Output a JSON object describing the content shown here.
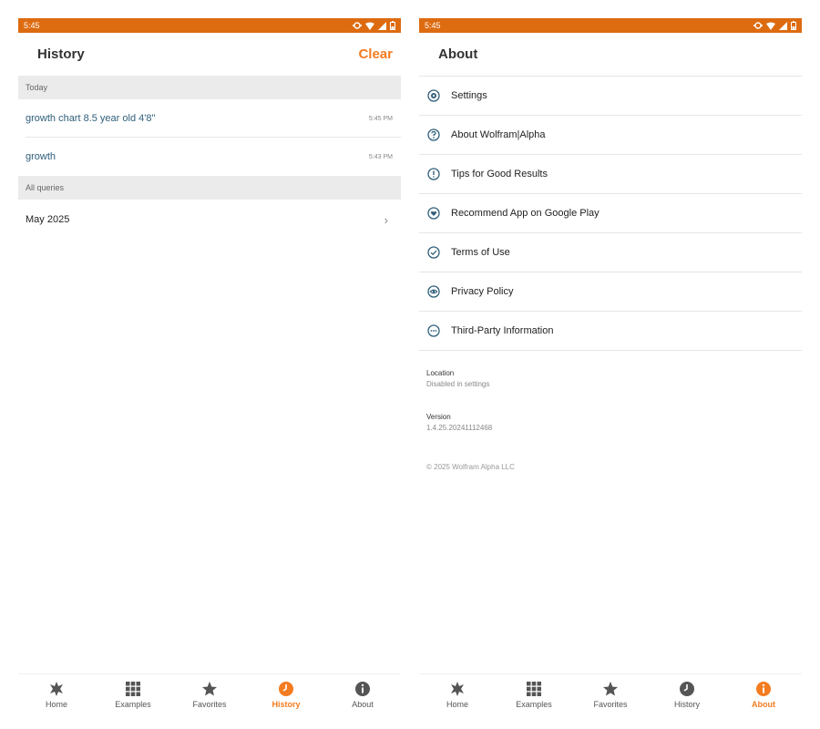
{
  "colors": {
    "accent": "#f47c20",
    "statusbar": "#dd6b10",
    "query_text": "#2f5f7a"
  },
  "left": {
    "status": {
      "time": "5:45"
    },
    "title": "History",
    "clear_label": "Clear",
    "sections": {
      "today": "Today",
      "all": "All queries"
    },
    "today_items": [
      {
        "query": "growth chart 8.5 year old 4'8\"",
        "time": "5:45 PM"
      },
      {
        "query": "growth",
        "time": "5:43 PM"
      }
    ],
    "months": [
      {
        "label": "May 2025",
        "chevron": "›"
      }
    ],
    "nav": [
      {
        "label": "Home",
        "icon": "wolfram-spikey-icon"
      },
      {
        "label": "Examples",
        "icon": "grid-icon"
      },
      {
        "label": "Favorites",
        "icon": "star-icon"
      },
      {
        "label": "History",
        "icon": "clock-icon",
        "active": true
      },
      {
        "label": "About",
        "icon": "info-icon"
      }
    ]
  },
  "right": {
    "status": {
      "time": "5:45"
    },
    "title": "About",
    "items": [
      {
        "label": "Settings",
        "icon": "gear-icon"
      },
      {
        "label": "About Wolfram|Alpha",
        "icon": "question-icon"
      },
      {
        "label": "Tips for Good Results",
        "icon": "exclamation-icon"
      },
      {
        "label": "Recommend App on Google Play",
        "icon": "heart-icon"
      },
      {
        "label": "Terms of Use",
        "icon": "check-icon"
      },
      {
        "label": "Privacy Policy",
        "icon": "eye-icon"
      },
      {
        "label": "Third-Party Information",
        "icon": "more-icon"
      }
    ],
    "location": {
      "label": "Location",
      "value": "Disabled in settings"
    },
    "version": {
      "label": "Version",
      "value": "1.4.25.20241112468"
    },
    "copyright": "© 2025 Wolfram Alpha LLC",
    "nav": [
      {
        "label": "Home",
        "icon": "wolfram-spikey-icon"
      },
      {
        "label": "Examples",
        "icon": "grid-icon"
      },
      {
        "label": "Favorites",
        "icon": "star-icon"
      },
      {
        "label": "History",
        "icon": "clock-icon"
      },
      {
        "label": "About",
        "icon": "info-icon",
        "active": true
      }
    ]
  }
}
